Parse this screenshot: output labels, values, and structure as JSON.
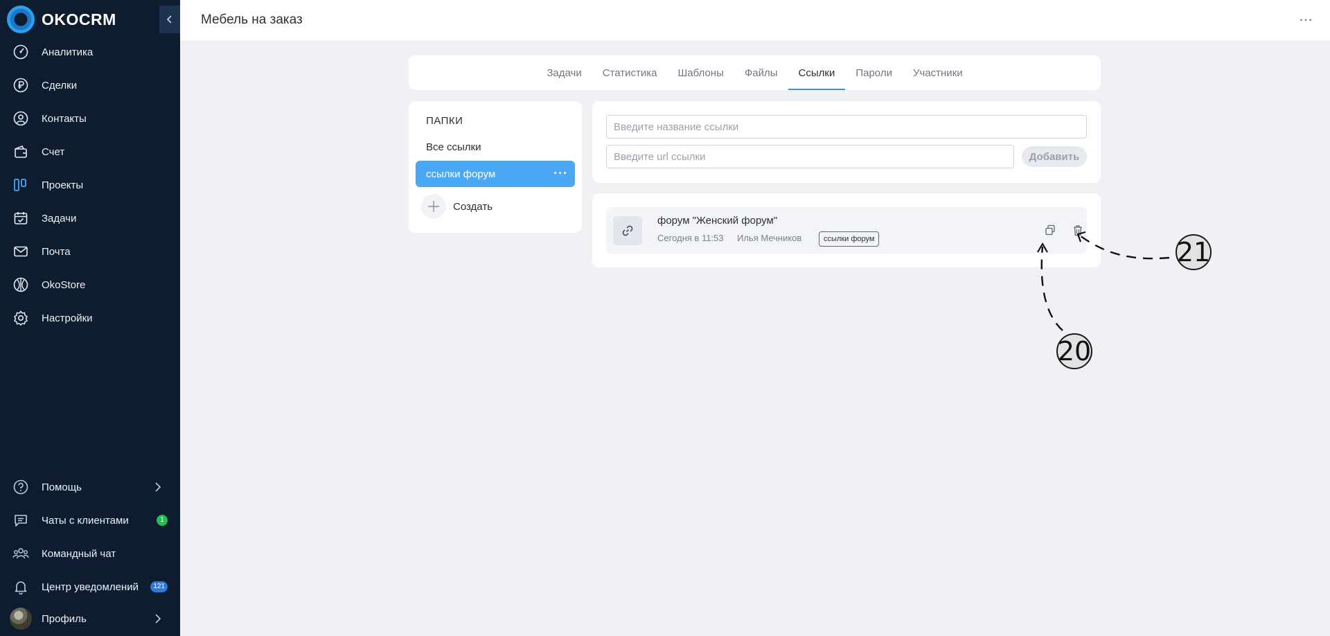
{
  "brand": {
    "name": "OKOCRM"
  },
  "sidebar": {
    "items": [
      {
        "label": "Аналитика",
        "icon": "speedometer-icon"
      },
      {
        "label": "Сделки",
        "icon": "ruble-icon"
      },
      {
        "label": "Контакты",
        "icon": "person-icon"
      },
      {
        "label": "Счет",
        "icon": "wallet-icon"
      },
      {
        "label": "Проекты",
        "icon": "kanban-icon"
      },
      {
        "label": "Задачи",
        "icon": "calendar-check-icon"
      },
      {
        "label": "Почта",
        "icon": "mail-icon"
      },
      {
        "label": "OkoStore",
        "icon": "store-icon"
      },
      {
        "label": "Настройки",
        "icon": "gear-icon"
      }
    ],
    "bottom": [
      {
        "label": "Помощь",
        "icon": "help-icon"
      },
      {
        "label": "Чаты с клиентами",
        "icon": "chat-icon",
        "badge": "1"
      },
      {
        "label": "Командный чат",
        "icon": "team-icon"
      },
      {
        "label": "Центр уведомлений",
        "icon": "bell-icon",
        "badge": "121"
      },
      {
        "label": "Профиль",
        "icon": "avatar"
      }
    ]
  },
  "header": {
    "title": "Мебель на заказ"
  },
  "tabs": [
    {
      "label": "Задачи"
    },
    {
      "label": "Статистика"
    },
    {
      "label": "Шаблоны"
    },
    {
      "label": "Файлы"
    },
    {
      "label": "Ссылки",
      "active": true
    },
    {
      "label": "Пароли"
    },
    {
      "label": "Участники"
    }
  ],
  "folders": {
    "title": "ПАПКИ",
    "items": [
      {
        "label": "Все ссылки"
      },
      {
        "label": "ссылки форум",
        "active": true
      }
    ],
    "create_label": "Создать"
  },
  "form": {
    "name_placeholder": "Введите название ссылки",
    "url_placeholder": "Введите url ссылки",
    "add_label": "Добавить"
  },
  "links": [
    {
      "title": "форум \"Женский форум\"",
      "date": "Сегодня в 11:53",
      "author": "Илья Мечников",
      "folder_tag": "ссылки форум"
    }
  ],
  "annotations": {
    "copy_marker": "20",
    "delete_marker": "21"
  },
  "colors": {
    "sidebar_bg": "#0e1c2f",
    "accent": "#4aa8f5",
    "page_bg": "#eff1f5",
    "badge_green": "#1fbf55",
    "badge_blue": "#2a7bdc"
  }
}
